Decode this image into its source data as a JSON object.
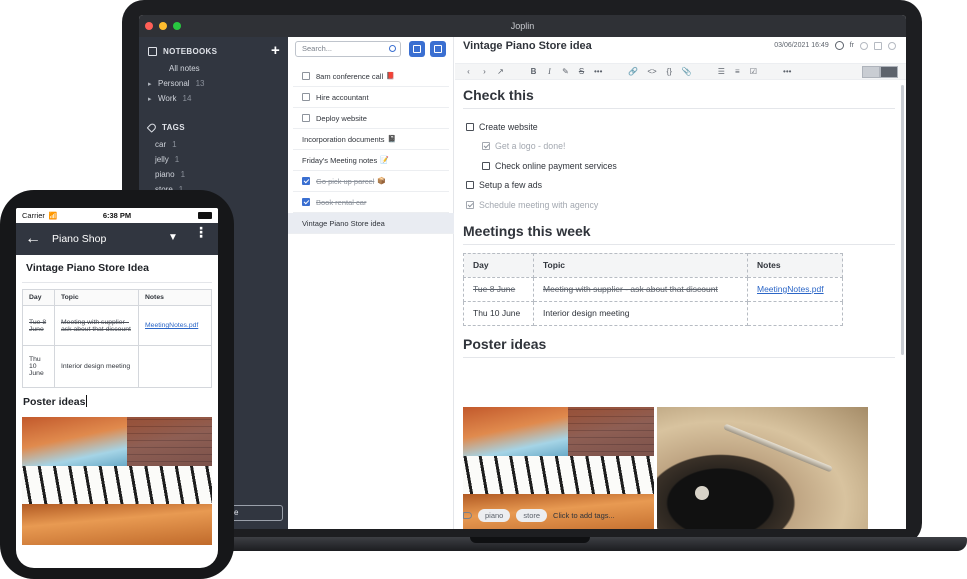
{
  "app": {
    "window_title": "Joplin",
    "traffic_lights": [
      "#ff5f57",
      "#febc2e",
      "#28c840"
    ]
  },
  "sidebar": {
    "notebooks_header": "NOTEBOOKS",
    "add_label": "+",
    "all_notes": "All notes",
    "folders": [
      {
        "label": "Personal",
        "count": "13"
      },
      {
        "label": "Work",
        "count": "14"
      }
    ],
    "tags_header": "TAGS",
    "tags": [
      {
        "label": "car",
        "count": "1"
      },
      {
        "label": "jelly",
        "count": "1"
      },
      {
        "label": "piano",
        "count": "1"
      },
      {
        "label": "store",
        "count": "1"
      }
    ],
    "sync_button": "se"
  },
  "notelist": {
    "search_placeholder": "Search...",
    "items": [
      {
        "label": "8am conference call",
        "emoji": "📕",
        "todo": true,
        "done": false
      },
      {
        "label": "Hire accountant",
        "emoji": "",
        "todo": true,
        "done": false
      },
      {
        "label": "Deploy website",
        "emoji": "",
        "todo": true,
        "done": false
      },
      {
        "label": "Incorporation documents",
        "emoji": "📓",
        "todo": false,
        "done": false
      },
      {
        "label": "Friday's Meeting notes",
        "emoji": "📝",
        "todo": false,
        "done": false
      },
      {
        "label": "Go pick up parcel",
        "emoji": "📦",
        "todo": true,
        "done": true
      },
      {
        "label": "Book rental car",
        "emoji": "",
        "todo": true,
        "done": true
      },
      {
        "label": "Vintage Piano Store idea",
        "emoji": "",
        "todo": false,
        "done": false,
        "selected": true
      }
    ]
  },
  "editor": {
    "title": "Vintage Piano Store idea",
    "date": "03/06/2021 16:49",
    "lang": "fr",
    "toolbar": {
      "back": "‹",
      "forward": "›",
      "external": "↗",
      "bold": "B",
      "italic": "I",
      "highlight": "✎",
      "strike": "S",
      "more1": "•••",
      "link": "🔗",
      "code": "<>",
      "code_block": "{}",
      "attach": "📎",
      "ul": "☰",
      "ol": "≡",
      "checklist": "☑",
      "more2": "•••"
    },
    "section1": "Check this",
    "checklist": [
      {
        "label": "Create website",
        "level": 1,
        "done": false
      },
      {
        "label": "Get a logo - done!",
        "level": 2,
        "done": true
      },
      {
        "label": "Check online payment services",
        "level": 2,
        "done": false
      },
      {
        "label": "Setup a few ads",
        "level": 1,
        "done": false
      },
      {
        "label": "Schedule meeting with agency",
        "level": 1,
        "done": true
      }
    ],
    "section2": "Meetings this week",
    "table": {
      "headers": [
        "Day",
        "Topic",
        "Notes"
      ],
      "rows": [
        {
          "day": "Tue 8 June",
          "topic": "Meeting with supplier - ask about that discount",
          "notes": "MeetingNotes.pdf",
          "struck": true
        },
        {
          "day": "Thu 10 June",
          "topic": "Interior design meeting",
          "notes": "",
          "struck": false
        }
      ]
    },
    "section3": "Poster ideas",
    "tags": [
      "piano",
      "store"
    ],
    "add_tags": "Click to add tags..."
  },
  "phone": {
    "carrier": "Carrier",
    "wifi": "📶",
    "time": "6:38 PM",
    "back": "←",
    "notebook": "Piano Shop",
    "dropdown": "▼",
    "more": "⋮",
    "note_title": "Vintage Piano Store Idea",
    "table": {
      "headers": [
        "Day",
        "Topic",
        "Notes"
      ],
      "rows": [
        {
          "day": "Tue 8 June",
          "topic": "Meeting with supplier - ask about that discount",
          "notes": "MeetingNotes.pdf"
        },
        {
          "day": "Thu 10 June",
          "topic": "Interior design meeting",
          "notes": ""
        }
      ]
    },
    "section": "Poster ideas"
  }
}
